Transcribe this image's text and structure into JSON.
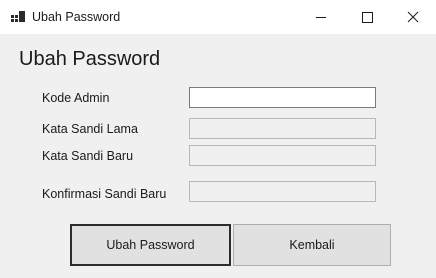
{
  "window": {
    "title": "Ubah Password",
    "app_icon": "winforms-app-icon",
    "controls": {
      "minimize_icon": "minimize-icon",
      "maximize_icon": "maximize-icon",
      "close_icon": "close-icon"
    }
  },
  "form": {
    "heading": "Ubah Password",
    "fields": [
      {
        "label": "Kode Admin",
        "value": "",
        "enabled": true
      },
      {
        "label": "Kata Sandi Lama",
        "value": "",
        "enabled": false
      },
      {
        "label": "Kata Sandi Baru",
        "value": "",
        "enabled": false
      },
      {
        "label": "Konfirmasi Sandi Baru",
        "value": "",
        "enabled": false
      }
    ],
    "buttons": {
      "submit_label": "Ubah Password",
      "back_label": "Kembali"
    }
  },
  "colors": {
    "window_background": "#f0f0f0",
    "titlebar_background": "#ffffff",
    "button_face": "#e1e1e1",
    "input_enabled": "#ffffff",
    "input_disabled": "#f0f0f0"
  }
}
